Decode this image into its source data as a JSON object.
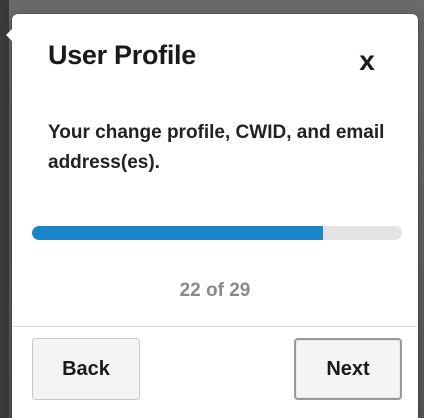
{
  "dialog": {
    "title": "User Profile",
    "close_label": "x",
    "description": "Your change profile, CWID, and email address(es).",
    "progress": {
      "current": 22,
      "total": 29,
      "fraction": 0.7857,
      "counter_text": "22 of 29"
    },
    "buttons": {
      "back_label": "Back",
      "next_label": "Next"
    }
  },
  "colors": {
    "progress_fill": "#1a86c8",
    "progress_track": "#e3e3e3",
    "backdrop": "#5f5f5f"
  }
}
